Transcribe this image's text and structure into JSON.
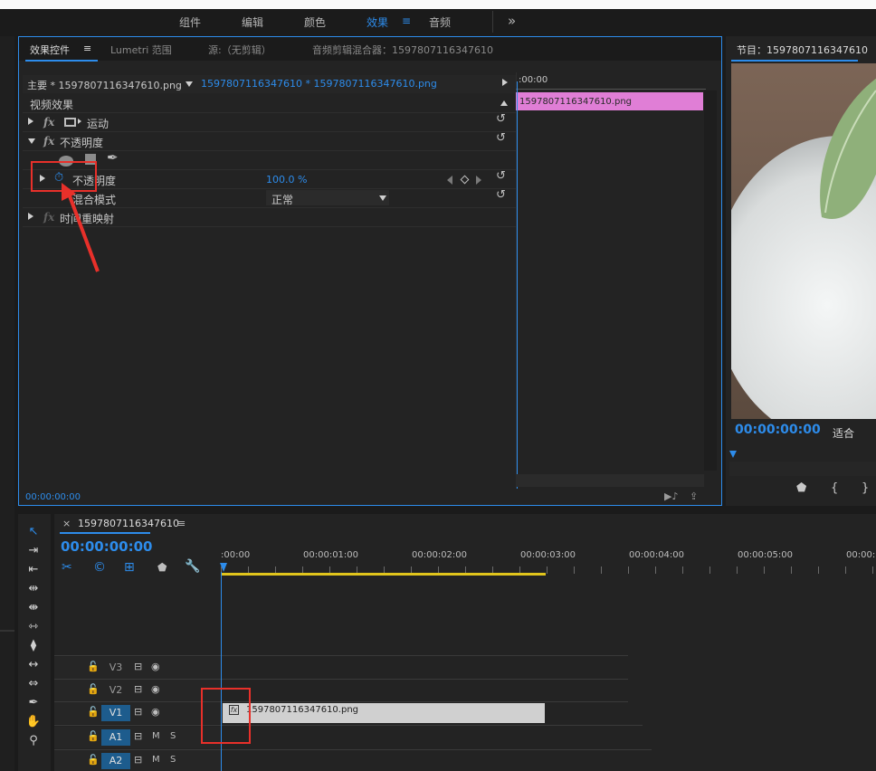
{
  "workspace_tabs": [
    {
      "label": "组件"
    },
    {
      "label": "编辑"
    },
    {
      "label": "颜色"
    },
    {
      "label": "效果"
    },
    {
      "label": "音频"
    }
  ],
  "workspace_menu_icon": "≡",
  "workspace_more": "»",
  "effect_panel": {
    "tabs": {
      "effect_controls": "效果控件",
      "lumetri": "Lumetri 范围",
      "source": "源:（无剪辑）",
      "audio_mixer": "音频剪辑混合器：1597807116347610"
    },
    "master_clip": "主要 * 1597807116347610.png",
    "sequence_clip": "1597807116347610 * 1597807116347610.png",
    "section_title": "视频效果",
    "effects": {
      "motion": "运动",
      "opacity": "不透明度",
      "opacity_param": "不透明度",
      "opacity_value": "100.0 %",
      "blend_mode_label": "混合模式",
      "blend_mode_value": "正常",
      "time_remap": "时间重映射"
    },
    "fx_label": "fx",
    "mini_timeline_time": ":00:00",
    "mini_clip_label": "1597807116347610.png",
    "footer_time": "00:00:00:00"
  },
  "program_monitor": {
    "title": "节目：1597807116347610",
    "timecode": "00:00:00:00",
    "fit": "适合"
  },
  "timeline": {
    "sequence_name": "1597807116347610",
    "close": "×",
    "menu": "≡",
    "timecode": "00:00:00:00",
    "ruler": [
      ":00:00",
      "00:00:01:00",
      "00:00:02:00",
      "00:00:03:00",
      "00:00:04:00",
      "00:00:05:00",
      "00:00:"
    ],
    "tracks": [
      {
        "name": "V3",
        "active": false
      },
      {
        "name": "V2",
        "active": false
      },
      {
        "name": "V1",
        "active": true
      },
      {
        "name": "A1",
        "active": true
      },
      {
        "name": "A2",
        "active": true
      }
    ],
    "clip_label": "1597807116347610.png",
    "clip_fx": "fx",
    "audio_m": "M",
    "audio_s": "S"
  },
  "colors": {
    "accent_blue": "#2d8ceb",
    "clip_pink": "#e07ed6",
    "annotation_red": "#e8302a",
    "work_area_yellow": "#e1c51c"
  }
}
